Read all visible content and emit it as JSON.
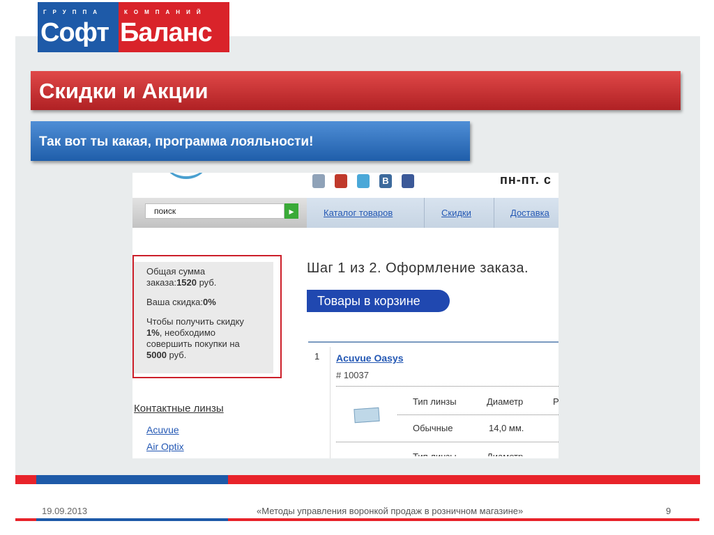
{
  "logo": {
    "tagline_left": "ГРУППА",
    "tagline_right": "КОМПАНИЙ",
    "word_left": "Софт",
    "word_right": "Баланс"
  },
  "slide": {
    "title": "Скидки и Акции",
    "subtitle": "Так вот ты какая, программа  лояльности!"
  },
  "screenshot": {
    "header_text": "пн-пт. с",
    "social_icons": [
      "phone-icon",
      "youtube-icon",
      "twitter-icon",
      "vkontakte-icon",
      "facebook-icon"
    ],
    "search": {
      "value": "поиск"
    },
    "nav": [
      "Каталог товаров",
      "Скидки",
      "Доставка"
    ],
    "sidebar_box": {
      "sum_line1": "Общая сумма",
      "sum_line2_prefix": "заказа:",
      "sum_value": "1520",
      "sum_currency": " руб.",
      "discount_prefix": "Ваша скидка:",
      "discount_value": "0%",
      "note_line1": "Чтобы получить скидку",
      "note_pct": "1%",
      "note_line2_rest": ", необходимо",
      "note_line3": "совершить покупки на",
      "note_amount": "5000",
      "note_currency": " руб."
    },
    "contacts": {
      "heading": "Контактные линзы",
      "brands": [
        "Acuvue",
        "Air Optix"
      ]
    },
    "order": {
      "step_title": "Шаг 1 из 2. Оформление заказа.",
      "cart_button": "Товары в корзине",
      "row_number": "1",
      "product_name": "Acuvue Oasys",
      "sku": "# 10037",
      "col_headers": [
        "Тип линзы",
        "Диаметр",
        "Р"
      ],
      "row_values": [
        "Обычные",
        "14,0 мм."
      ],
      "cut_headers": [
        "Тип линзы",
        "Диаметр"
      ]
    }
  },
  "footer": {
    "date": "19.09.2013",
    "title": "«Методы управления воронкой продаж в розничном магазине»",
    "page": "9"
  }
}
